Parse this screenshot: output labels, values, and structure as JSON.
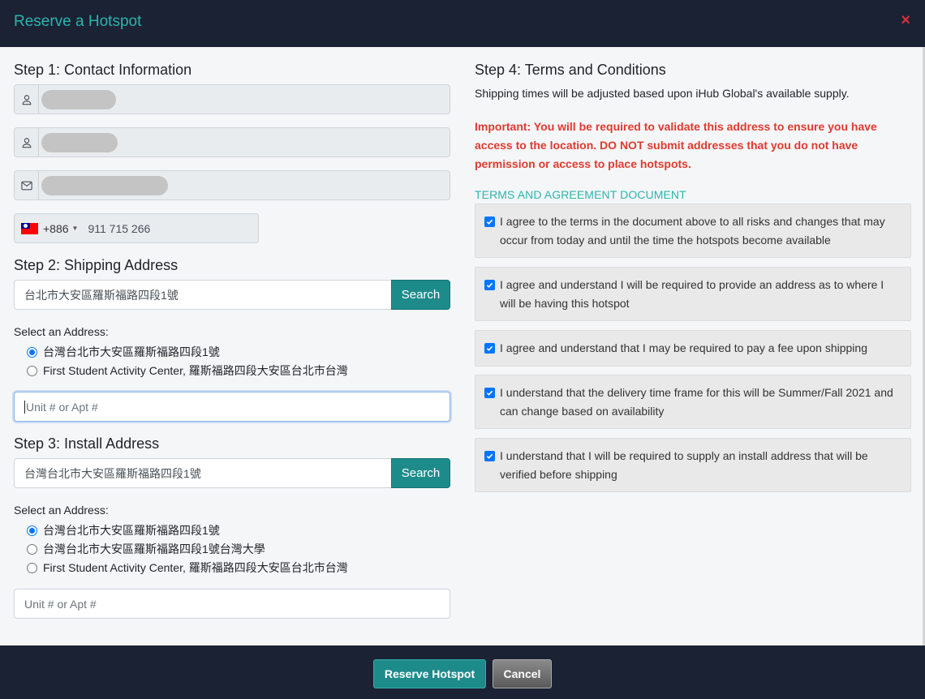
{
  "modal": {
    "title": "Reserve a Hotspot",
    "close_symbol": "×"
  },
  "step1": {
    "heading": "Step 1: Contact Information",
    "phone": {
      "dial_code": "+886",
      "number": "911 715 266"
    }
  },
  "step2": {
    "heading": "Step 2: Shipping Address",
    "search_value": "台北市大安區羅斯福路四段1號",
    "search_label": "Search",
    "select_label": "Select an Address:",
    "options": [
      "台灣台北市大安區羅斯福路四段1號",
      "First Student Activity Center, 羅斯福路四段大安區台北市台灣"
    ],
    "selected_index": 0,
    "unit_placeholder": "Unit # or Apt #"
  },
  "step3": {
    "heading": "Step 3: Install Address",
    "search_value": "台灣台北市大安區羅斯福路四段1號",
    "search_label": "Search",
    "select_label": "Select an Address:",
    "options": [
      "台灣台北市大安區羅斯福路四段1號",
      "台灣台北市大安區羅斯福路四段1號台灣大學",
      "First Student Activity Center, 羅斯福路四段大安區台北市台灣"
    ],
    "selected_index": 0,
    "unit_placeholder": "Unit # or Apt #"
  },
  "step4": {
    "heading": "Step 4: Terms and Conditions",
    "description": "Shipping times will be adjusted based upon iHub Global's available supply.",
    "important": "Important: You will be required to validate this address to ensure you have access to the location. DO NOT submit addresses that you do not have permission or access to place hotspots.",
    "document_link": "TERMS AND AGREEMENT DOCUMENT",
    "terms": [
      {
        "text": "I agree to the terms in the document above to all risks and changes that may occur from today and until the time the hotspots become available",
        "checked": true
      },
      {
        "text": "I agree and understand I will be required to provide an address as to where I will be having this hotspot",
        "checked": true
      },
      {
        "text": "I agree and understand that I may be required to pay a fee upon shipping",
        "checked": true
      },
      {
        "text": "I understand that the delivery time frame for this will be Summer/Fall 2021 and can change based on availability",
        "checked": true
      },
      {
        "text": "I understand that I will be required to supply an install address that will be verified before shipping",
        "checked": true
      }
    ]
  },
  "footer": {
    "reserve_label": "Reserve Hotspot",
    "cancel_label": "Cancel"
  },
  "colors": {
    "accent": "#2bb5ad",
    "button_teal": "#1e8b8b",
    "important_red": "#e03a2f",
    "close_red": "#d9303a",
    "header_bg": "#1a2233"
  },
  "icons": {
    "first_name": "user-icon",
    "last_name": "user-icon",
    "email": "envelope-icon",
    "country": "taiwan-flag-icon",
    "close": "close-icon",
    "check": "checkmark-icon"
  }
}
